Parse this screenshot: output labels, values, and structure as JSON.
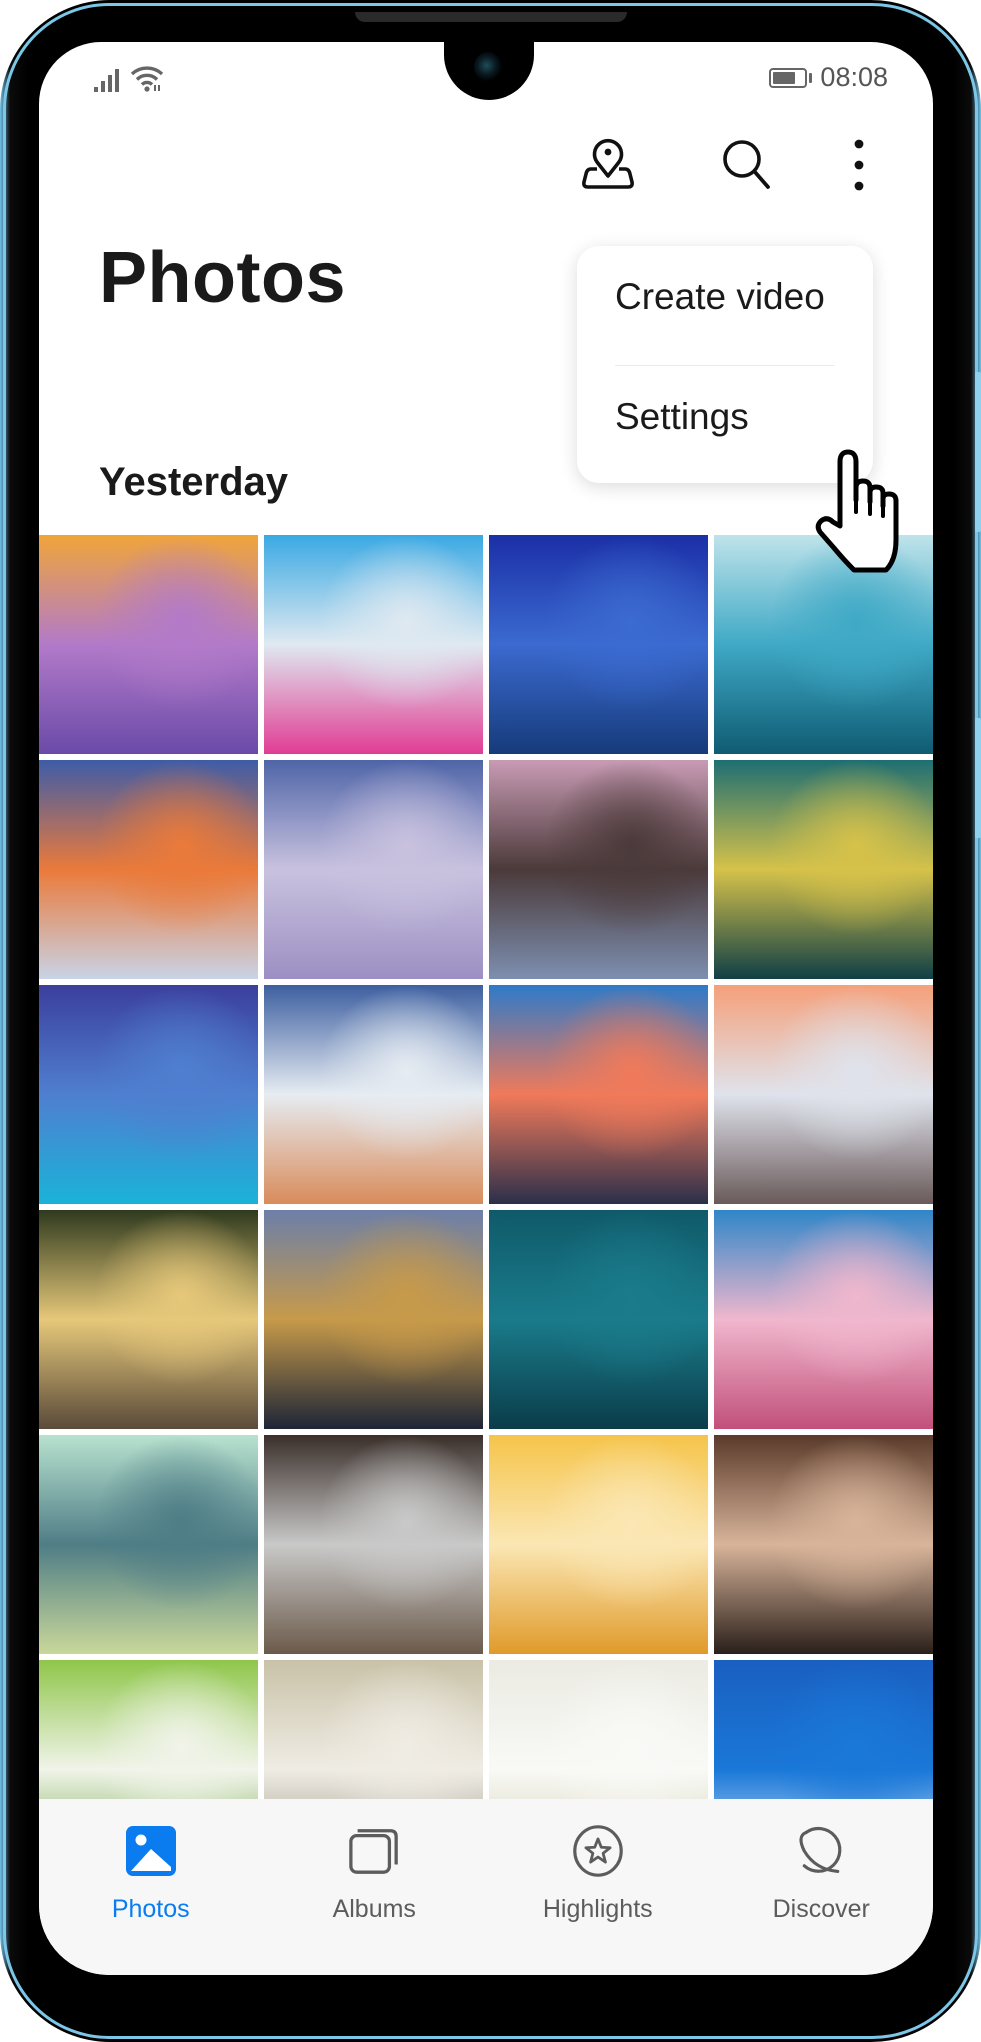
{
  "status_bar": {
    "signal_icon": "cellular-signal-icon",
    "wifi_icon": "wifi-icon",
    "battery_icon": "battery-icon",
    "battery_level": 0.75,
    "time": "08:08"
  },
  "app_bar": {
    "actions": [
      {
        "name": "map-location-icon",
        "label": "Map"
      },
      {
        "name": "search-icon",
        "label": "Search"
      },
      {
        "name": "more-options-icon",
        "label": "More"
      }
    ]
  },
  "page": {
    "title": "Photos",
    "section_header": "Yesterday"
  },
  "overflow_menu": {
    "items": [
      {
        "label": "Create video"
      },
      {
        "label": "Settings"
      }
    ]
  },
  "photos": [
    {
      "subject": "lavender-field-sunset",
      "colors": [
        "#f0a53a",
        "#b27ac9",
        "#6a4aa8"
      ]
    },
    {
      "subject": "abstract-paint",
      "colors": [
        "#3aa9e3",
        "#dfe9f1",
        "#e03c93"
      ]
    },
    {
      "subject": "night-sky-coast",
      "colors": [
        "#1b2fa6",
        "#3b6ad0",
        "#163b7a"
      ]
    },
    {
      "subject": "iceberg-water",
      "colors": [
        "#bfe3ea",
        "#3fa9c6",
        "#0f5b72"
      ]
    },
    {
      "subject": "color-powder-explosion",
      "colors": [
        "#3e5ca8",
        "#ea7a3a",
        "#c9d3e6"
      ]
    },
    {
      "subject": "snowy-field-trees",
      "colors": [
        "#4f65a8",
        "#c9c2df",
        "#9c8fc3"
      ]
    },
    {
      "subject": "waterfall-cliffs",
      "colors": [
        "#c89bb4",
        "#4b3a3a",
        "#7d8fb0"
      ]
    },
    {
      "subject": "ocean-wave-tunnel",
      "colors": [
        "#1e6e72",
        "#d6c24a",
        "#0f3f46"
      ]
    },
    {
      "subject": "tropical-lagoon-dusk",
      "colors": [
        "#3b3f9c",
        "#4f7fd0",
        "#1ab3d8"
      ]
    },
    {
      "subject": "mountain-lake-reflection",
      "colors": [
        "#3d5fa0",
        "#e6ecf2",
        "#d98b5a"
      ]
    },
    {
      "subject": "sunset-mountains",
      "colors": [
        "#2e7ac9",
        "#f07a5a",
        "#2b2f4a"
      ]
    },
    {
      "subject": "pier-boathouse",
      "colors": [
        "#f5a07a",
        "#dfe3ec",
        "#6a5a5a"
      ]
    },
    {
      "subject": "tudor-house-lantern",
      "colors": [
        "#2f3a1e",
        "#e6c87a",
        "#5a4a3a"
      ]
    },
    {
      "subject": "city-skyline-dusk",
      "colors": [
        "#6c7fa8",
        "#c79a4a",
        "#1d2537"
      ]
    },
    {
      "subject": "boat-aerial-sea",
      "colors": [
        "#0f5a6a",
        "#1a7b8a",
        "#0b3c4a"
      ]
    },
    {
      "subject": "magnolia-blossoms",
      "colors": [
        "#2f86c8",
        "#f0b7cd",
        "#c2507a"
      ]
    },
    {
      "subject": "glass-bottle-branch",
      "colors": [
        "#b8e2cf",
        "#4f7d86",
        "#c9d89a"
      ]
    },
    {
      "subject": "silver-teapots",
      "colors": [
        "#3a2f2a",
        "#c9c9c9",
        "#6b5a4a"
      ]
    },
    {
      "subject": "dandelion-macro",
      "colors": [
        "#f5c44a",
        "#fbe7b4",
        "#e09a2a"
      ]
    },
    {
      "subject": "violin-scroll",
      "colors": [
        "#5a3a2a",
        "#d8b49a",
        "#2a1f1a"
      ]
    },
    {
      "subject": "green-leaves",
      "colors": [
        "#8fc64a",
        "#f1f4ea",
        "#5a9a2a"
      ]
    },
    {
      "subject": "living-room-interior",
      "colors": [
        "#c9c2a8",
        "#efece4",
        "#8a8575"
      ]
    },
    {
      "subject": "white-orchid",
      "colors": [
        "#ebebe3",
        "#f9f9f6",
        "#c9cba8"
      ]
    },
    {
      "subject": "santorini-sea",
      "colors": [
        "#1a5fc0",
        "#1a78d8",
        "#eef4fb"
      ]
    }
  ],
  "bottom_nav": {
    "active_color": "#0a7cf0",
    "inactive_color": "#5c5c5c",
    "items": [
      {
        "label": "Photos",
        "icon": "photos-icon",
        "active": true
      },
      {
        "label": "Albums",
        "icon": "albums-icon",
        "active": false
      },
      {
        "label": "Highlights",
        "icon": "highlights-star-icon",
        "active": false
      },
      {
        "label": "Discover",
        "icon": "discover-planet-icon",
        "active": false
      }
    ]
  },
  "pointer": {
    "icon": "hand-pointer-icon",
    "target": "Settings"
  }
}
